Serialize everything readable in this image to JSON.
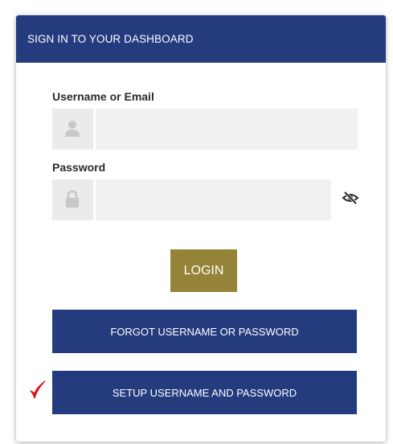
{
  "header": {
    "title": "SIGN IN TO YOUR DASHBOARD"
  },
  "form": {
    "username_label": "Username or Email",
    "username_value": "",
    "username_icon": "user-icon",
    "password_label": "Password",
    "password_value": "",
    "password_icon": "lock-icon",
    "password_toggle_icon": "eye-slash-icon"
  },
  "buttons": {
    "login": "LOGIN",
    "forgot": "FORGOT USERNAME OR PASSWORD",
    "setup": "SETUP USERNAME AND PASSWORD"
  },
  "annotation": {
    "marker_icon": "red-checkmark-icon"
  },
  "colors": {
    "header_bg": "#243b7e",
    "login_bg": "#958437",
    "button_bg": "#243b7e",
    "checkmark": "#e0101a"
  }
}
